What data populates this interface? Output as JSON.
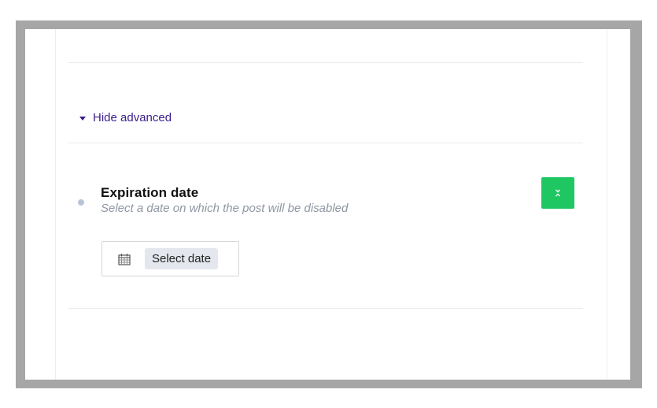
{
  "advanced": {
    "toggle_label": "Hide advanced"
  },
  "expiration": {
    "title": "Expiration date",
    "description": "Select a date on which the post will be disabled",
    "select_date_label": "Select date"
  },
  "icons": {
    "toggle": "caret-down-icon",
    "collapse": "chevrons-collapse-icon",
    "calendar": "calendar-icon",
    "status": "status-dot"
  },
  "colors": {
    "link": "#3a1d8c",
    "accent_green": "#1ec761",
    "status_dot": "#b9c4d9",
    "muted_text": "#8f96a3"
  }
}
